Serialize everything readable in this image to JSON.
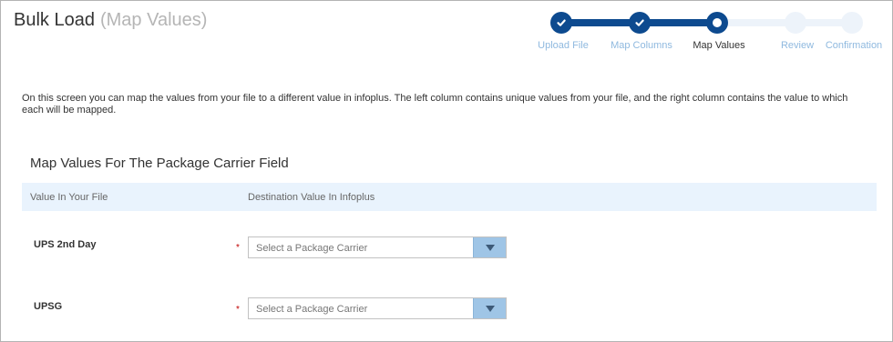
{
  "header": {
    "title": "Bulk Load",
    "subtitle": "(Map Values)"
  },
  "wizard": {
    "current_step": 3,
    "steps": [
      {
        "label": "Upload File",
        "state": "done"
      },
      {
        "label": "Map Columns",
        "state": "done"
      },
      {
        "label": "Map Values",
        "state": "current"
      },
      {
        "label": "Review",
        "state": "todo"
      },
      {
        "label": "Confirmation",
        "state": "todo"
      }
    ]
  },
  "intro": "On this screen you can map the values from your file to a different value in infoplus. The left column contains unique values from your file, and the right column contains the value to which each will be mapped.",
  "section": {
    "title": "Map Values For The Package Carrier Field",
    "columns": [
      "Value In Your File",
      "Destination Value In Infoplus"
    ]
  },
  "rows": [
    {
      "value": "UPS 2nd Day",
      "required": "*",
      "placeholder": "Select a Package Carrier"
    },
    {
      "value": "UPSG",
      "required": "*",
      "placeholder": "Select a Package Carrier"
    }
  ],
  "colors": {
    "accent": "#0d4a8f",
    "step_label": "#8fb9df",
    "header_bg": "#e9f3fd",
    "select_button": "#9fc5e6"
  },
  "icons": {
    "step_done": "check-icon",
    "select_toggle": "caret-down-icon"
  }
}
